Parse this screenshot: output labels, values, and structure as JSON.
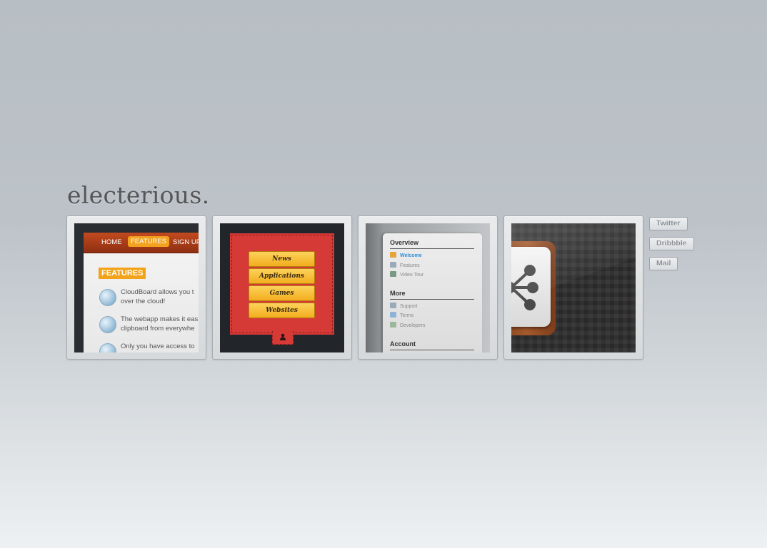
{
  "site": {
    "title": "electerious."
  },
  "thumb1": {
    "nav": [
      "HOME",
      "FEATURES",
      "SIGN UP"
    ],
    "heading": "FEATURES",
    "items": [
      {
        "line1": "CloudBoard allows you t",
        "line2": "over the cloud!"
      },
      {
        "line1": "The webapp makes it eas",
        "line2": "clipboard from everywhe"
      },
      {
        "line1": "Only you have access to",
        "line2": ""
      }
    ]
  },
  "thumb2": {
    "menu": [
      "News",
      "Applications",
      "Games",
      "Websites"
    ],
    "tab_icon": "person-icon"
  },
  "thumb3": {
    "sections": [
      {
        "title": "Overview",
        "items": [
          "Welcome",
          "Features",
          "Video Tour"
        ]
      },
      {
        "title": "More",
        "items": [
          "Support",
          "Terms",
          "Developers"
        ]
      },
      {
        "title": "Account",
        "items": []
      }
    ]
  },
  "thumb4": {
    "icon": "share-nodes-icon"
  },
  "social": {
    "twitter": "Twitter",
    "dribbble": "Dribbble",
    "mail": "Mail"
  },
  "colors": {
    "background_top": "#b7bec4",
    "background_bottom": "#eef1f3",
    "accent_orange": "#f3a319",
    "accent_red": "#d63a36"
  }
}
